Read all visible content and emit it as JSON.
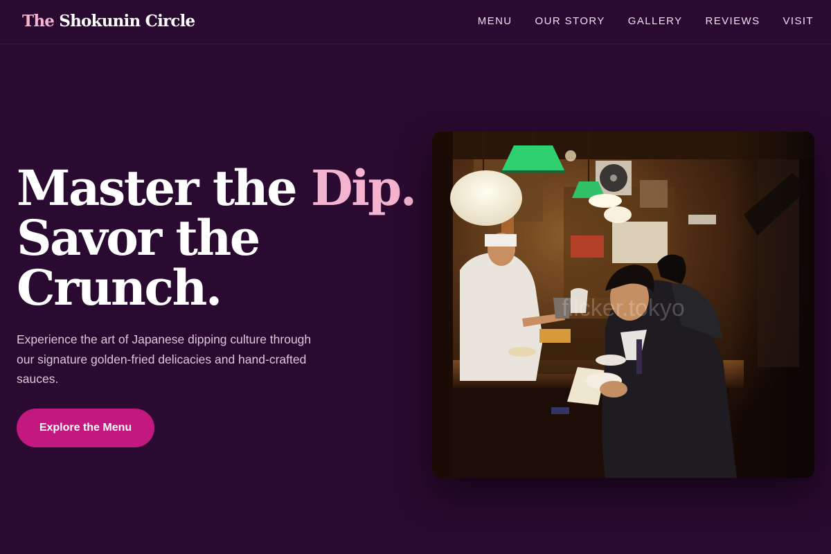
{
  "brand": {
    "accent": "The",
    "rest": " Shokunin Circle"
  },
  "nav": [
    {
      "id": "menu",
      "label": "MENU"
    },
    {
      "id": "our-story",
      "label": "OUR STORY"
    },
    {
      "id": "gallery",
      "label": "GALLERY"
    },
    {
      "id": "reviews",
      "label": "REVIEWS"
    },
    {
      "id": "visit",
      "label": "VISIT"
    }
  ],
  "hero": {
    "line1_plain": "Master the ",
    "line1_accent": "Dip.",
    "line2": "Savor the",
    "line3": "Crunch.",
    "description": "Experience the art of Japanese dipping culture through our signature golden-fried delicacies and hand-crafted sauces.",
    "cta_label": "Explore the Menu",
    "image_watermark": "flicker.tokyo"
  },
  "colors": {
    "background": "#2a0a30",
    "accent_pink": "#f4b3cf",
    "cta": "#c2187f",
    "text_muted": "#dcc8dd"
  }
}
